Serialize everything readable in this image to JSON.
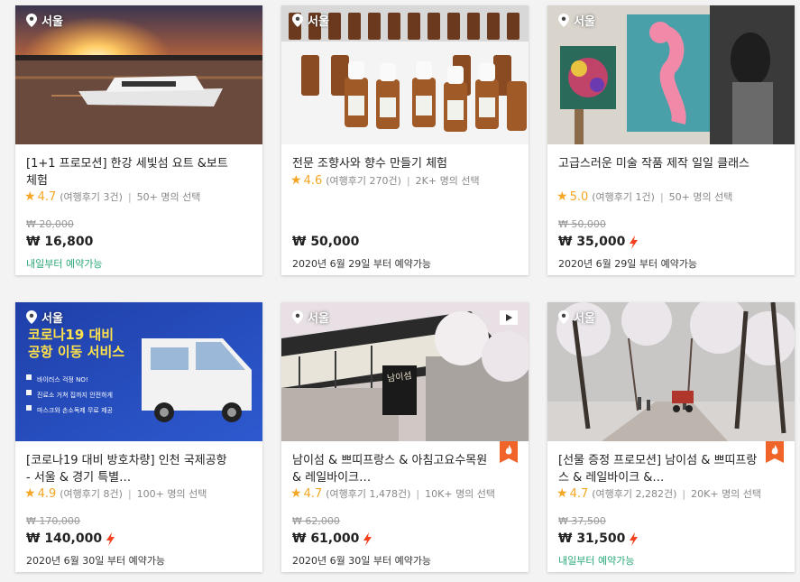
{
  "cards": [
    {
      "location": "서울",
      "title": "[1+1 프로모션] 한강 세빛섬 요트 &보트 체험",
      "score": "4.7",
      "reviews": "(여행후기 3건)",
      "chosen": "50+ 명의 선택",
      "original_price": "₩ 20,000",
      "price": "₩ 16,800",
      "availability": "내일부터 예약가능"
    },
    {
      "location": "서울",
      "title": "전문 조향사와 향수 만들기 체험",
      "score": "4.6",
      "reviews": "(여행후기 270건)",
      "chosen": "2K+ 명의 선택",
      "original_price": "",
      "price": "₩ 50,000",
      "availability": "2020년 6월 29일 부터 예약가능"
    },
    {
      "location": "서울",
      "title": "고급스러운 미술 작품 제작 일일 클래스",
      "score": "5.0",
      "reviews": "(여행후기 1건)",
      "chosen": "50+ 명의 선택",
      "original_price": "₩ 50,000",
      "price": "₩ 35,000",
      "availability": "2020년 6월 29일 부터 예약가능"
    },
    {
      "location": "서울",
      "banner_line1": "코로나19 대비",
      "banner_line2": "공항 이동 서비스",
      "banner_items": [
        "바이러스 걱정 NO!",
        "진료소 거쳐 집까지 안전하게",
        "마스크와 손소독제 무료 제공"
      ],
      "title": "[코로나19 대비 방호차량] 인천 국제공항 - 서울 & 경기 특별…",
      "score": "4.9",
      "reviews": "(여행후기 8건)",
      "chosen": "100+ 명의 선택",
      "original_price": "₩ 170,000",
      "price": "₩ 140,000",
      "availability": "2020년 6월 30일 부터 예약가능"
    },
    {
      "location": "서울",
      "sign_text": "남이섬",
      "title": "남이섬 & 쁘띠프랑스 & 아침고요수목원 & 레일바이크…",
      "score": "4.7",
      "reviews": "(여행후기 1,478건)",
      "chosen": "10K+ 명의 선택",
      "original_price": "₩ 62,000",
      "price": "₩ 61,000",
      "availability": "2020년 6월 30일 부터 예약가능"
    },
    {
      "location": "서울",
      "title": "[선물 증정 프로모션] 남이섬 & 쁘띠프랑스 & 레일바이크 &…",
      "score": "4.7",
      "reviews": "(여행후기 2,282건)",
      "chosen": "20K+ 명의 선택",
      "original_price": "₩ 37,500",
      "price": "₩ 31,500",
      "availability": "내일부터 예약가능"
    }
  ],
  "colors": {
    "star": "#f5a623",
    "lightning": "#f5401d",
    "available_green": "#2aa876",
    "hot_badge": "#f0642a"
  },
  "icons": {
    "location": "location-pin-icon",
    "video": "play-video-icon",
    "hot": "flame-badge-icon",
    "deal": "lightning-icon",
    "rating": "star-icon"
  }
}
